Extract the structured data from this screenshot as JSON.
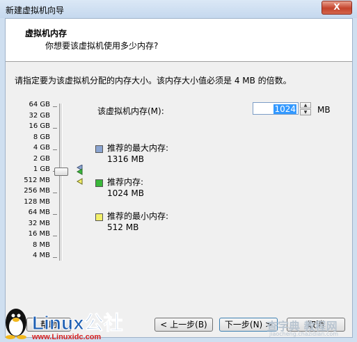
{
  "window": {
    "title": "新建虚拟机向导",
    "close_glyph": "X"
  },
  "header": {
    "title": "虚拟机内存",
    "subtitle": "你想要该虚拟机使用多少内存?"
  },
  "instruction": "请指定要为该虚拟机分配的内存大小。该内存大小值必须是 4 MB 的倍数。",
  "scale_labels": [
    "64 GB",
    "32 GB",
    "16 GB",
    "8 GB",
    "4 GB",
    "2 GB",
    "1 GB",
    "512 MB",
    "256 MB",
    "128 MB",
    "64 MB",
    "32 MB",
    "16 MB",
    "8 MB",
    "4 MB"
  ],
  "memory": {
    "label": "该虚拟机内存(M):",
    "value": "1024",
    "unit": "MB"
  },
  "legend": [
    {
      "label": "推荐的最大内存:",
      "value": "1316 MB",
      "color": "#8aa4d0"
    },
    {
      "label": "推荐内存:",
      "value": "1024 MB",
      "color": "#3ab83a"
    },
    {
      "label": "推荐的最小内存:",
      "value": "512 MB",
      "color": "#f2ef6a"
    }
  ],
  "buttons": {
    "help": "帮助",
    "back": "< 上一步(B)",
    "next": "下一步(N) >",
    "cancel": "取消"
  },
  "watermark": {
    "logo": "Linux公社",
    "url": "www.Linuxidc.com",
    "site": "查字典 教程网",
    "site_url": "jiaocheng.chazidian.com"
  }
}
